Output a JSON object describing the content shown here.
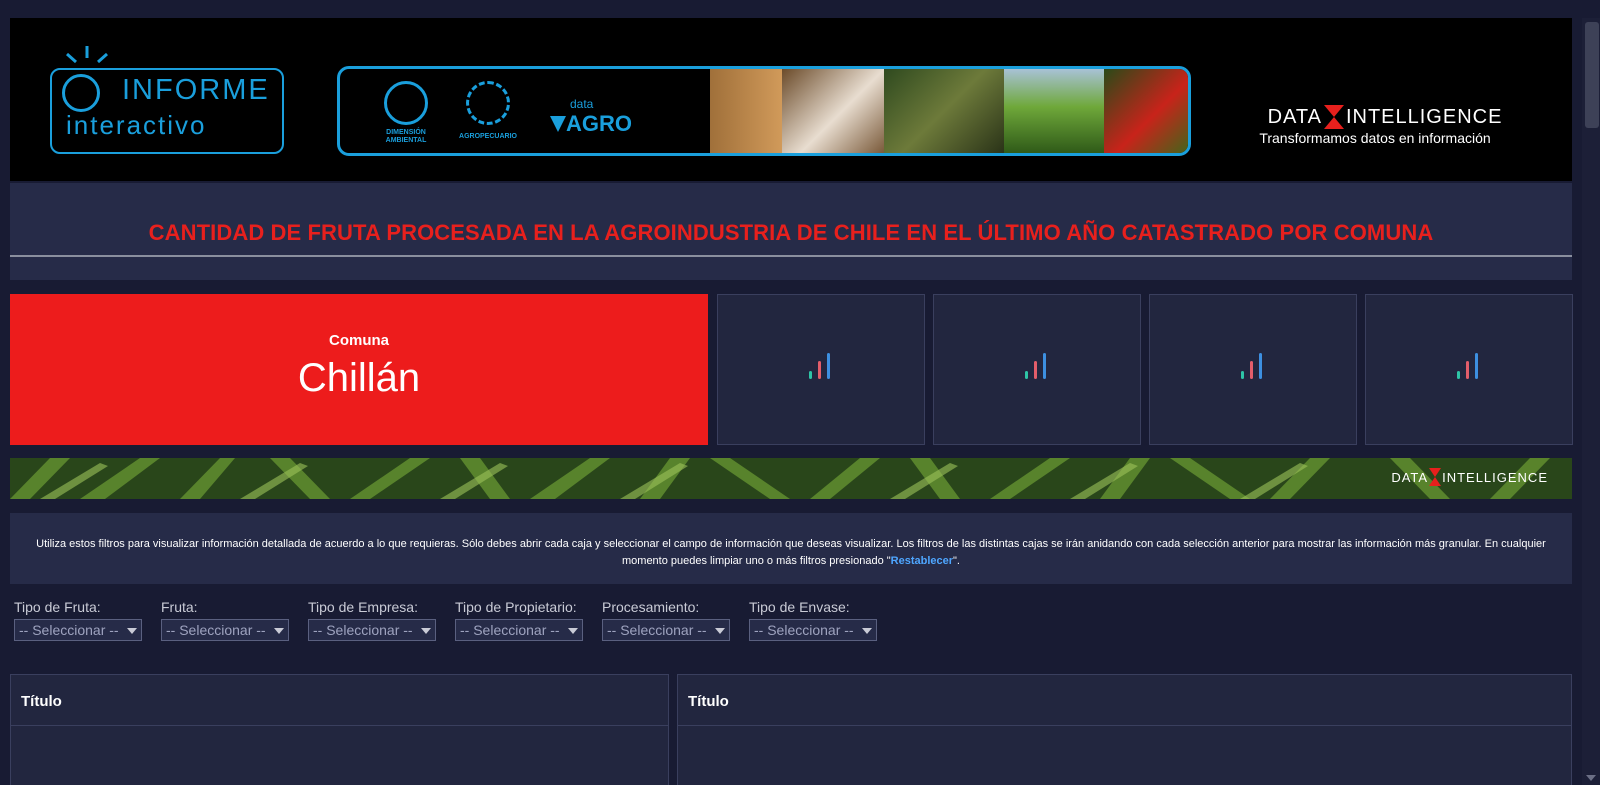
{
  "header": {
    "logo_word1": "INFORME",
    "logo_word2": "interactivo",
    "emblem1_label": "DIMENSIÓN\nAMBIENTAL",
    "emblem2_label": "AGROPECUARIO",
    "dataagro_small": "data",
    "dataagro_big": "AGRO",
    "brand_left": "DATA",
    "brand_right": "INTELLIGENCE",
    "tagline": "Transformamos datos en información"
  },
  "title": "CANTIDAD DE FRUTA PROCESADA EN LA AGROINDUSTRIA DE CHILE EN EL ÚLTIMO AÑO CATASTRADO POR COMUNA",
  "comuna": {
    "label": "Comuna",
    "value": "Chillán"
  },
  "strip_brand_left": "DATA",
  "strip_brand_right": "INTELLIGENCE",
  "info": {
    "text": "Utiliza estos filtros para visualizar información detallada de acuerdo a lo que requieras. Sólo debes abrir cada caja y seleccionar el campo de información que deseas visualizar. Los filtros de las distintas cajas se irán anidando con cada selección anterior para mostrar las información más granular. En cualquier momento puedes limpiar uno o más filtros presionado \"",
    "link": "Restablecer",
    "suffix": "\"."
  },
  "filters": [
    {
      "label": "Tipo de Fruta:",
      "value": "-- Seleccionar --"
    },
    {
      "label": "Fruta:",
      "value": "-- Seleccionar --"
    },
    {
      "label": "Tipo de Empresa:",
      "value": "-- Seleccionar --"
    },
    {
      "label": "Tipo de Propietario:",
      "value": "-- Seleccionar --"
    },
    {
      "label": "Procesamiento:",
      "value": "-- Seleccionar --"
    },
    {
      "label": "Tipo de Envase:",
      "value": "-- Seleccionar --"
    }
  ],
  "panels": [
    {
      "title": "Título"
    },
    {
      "title": "Título"
    }
  ],
  "colors": {
    "accent_red": "#ed1c1c",
    "brand_blue": "#1a9fdc",
    "bg": "#181b33",
    "panel": "#262b48"
  },
  "icons": {
    "kpi_loading": "bar-chart-loading-icon"
  }
}
